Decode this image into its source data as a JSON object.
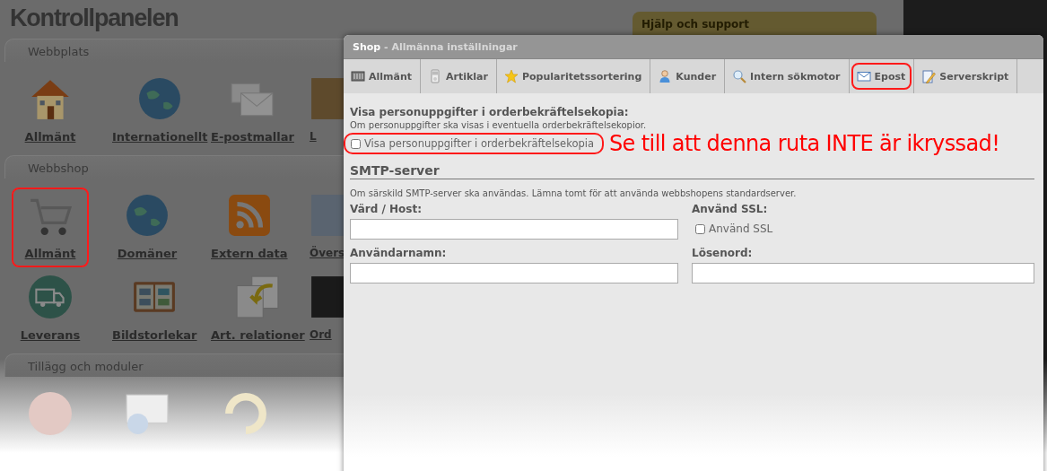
{
  "page": {
    "title": "Kontrollpanelen",
    "help_box": {
      "title": "Hjälp och support"
    },
    "sections": [
      {
        "title": "Webbplats",
        "items": [
          {
            "label": "Allmänt",
            "highlighted": false
          },
          {
            "label": "Internationellt",
            "highlighted": false
          },
          {
            "label": "E-postmallar",
            "highlighted": false
          },
          {
            "label": "L",
            "highlighted": false
          }
        ]
      },
      {
        "title": "Webbshop",
        "items": [
          {
            "label": "Allmänt",
            "highlighted": true
          },
          {
            "label": "Domäner",
            "highlighted": false
          },
          {
            "label": "Extern data",
            "highlighted": false
          },
          {
            "label": "Övers",
            "highlighted": false
          },
          {
            "label": "Leverans",
            "highlighted": false
          },
          {
            "label": "Bildstorlekar",
            "highlighted": false
          },
          {
            "label": "Art. relationer",
            "highlighted": false
          },
          {
            "label": "Ord",
            "highlighted": false
          }
        ]
      },
      {
        "title": "Tillägg och moduler",
        "items": [
          {
            "highlighted": false
          },
          {
            "highlighted": false
          },
          {
            "highlighted": false
          }
        ]
      }
    ]
  },
  "dialog": {
    "title": "**Shop** - Allmänna inställningar",
    "tabs": [
      {
        "label": "Allmänt",
        "highlighted": false
      },
      {
        "label": "Artiklar",
        "highlighted": false
      },
      {
        "label": "Popularitetssortering",
        "highlighted": false
      },
      {
        "label": "Kunder",
        "highlighted": false
      },
      {
        "label": "Intern sökmotor",
        "highlighted": false
      },
      {
        "label": "Epost",
        "highlighted": true
      },
      {
        "label": "Serverskript",
        "highlighted": false
      }
    ],
    "privacy": {
      "heading": "Visa personuppgifter i orderbekräftelsekopia:",
      "help": "Om personuppgifter ska visas i eventuella orderbekräftelsekopior.",
      "checkbox": {
        "label": "Visa personuppgifter i orderbekräftelsekopia",
        "checked": false,
        "highlighted": true
      },
      "annotation": "Se till att denna ruta INTE är ikryssad!"
    },
    "smtp": {
      "heading": "SMTP-server",
      "help": "Om särskild SMTP-server ska användas. Lämna tomt för att använda webbshopens standardserver.",
      "fields": [
        {
          "kind": "text",
          "label": "Värd / Host:"
        },
        {
          "kind": "checkbox",
          "label": "Använd SSL:",
          "option": "Använd SSL",
          "checked": false
        },
        {
          "kind": "text",
          "label": "Användarnamn:"
        },
        {
          "kind": "password",
          "label": "Lösenord:"
        }
      ]
    }
  }
}
